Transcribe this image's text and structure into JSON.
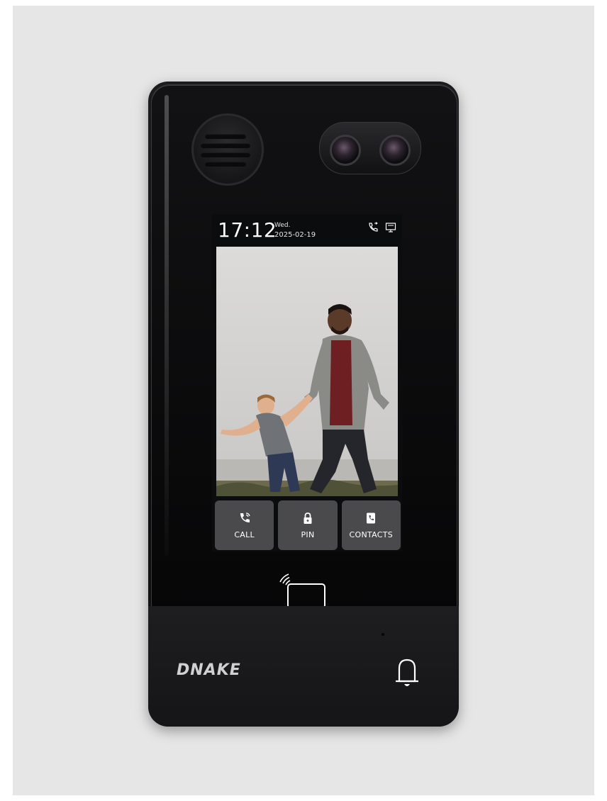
{
  "device": {
    "brand": "DNAKE",
    "screen": {
      "time": "17:12",
      "day": "Wed.",
      "date": "2025-02-19",
      "status_icons": [
        "phone-signal-icon",
        "monitor-icon"
      ]
    },
    "actions": [
      {
        "label": "CALL",
        "icon": "phone-icon"
      },
      {
        "label": "PIN",
        "icon": "lock-icon"
      },
      {
        "label": "CONTACTS",
        "icon": "contacts-icon"
      }
    ],
    "hardware": {
      "nfc": "nfc-card-reader-icon",
      "bell": "doorbell-icon",
      "speaker": "speaker-grille",
      "camera": "dual-camera"
    }
  },
  "colors": {
    "backdrop": "#e6e6e6",
    "device_body": "#111113",
    "button_bg": "#4a4a4d",
    "text": "#ffffff"
  }
}
